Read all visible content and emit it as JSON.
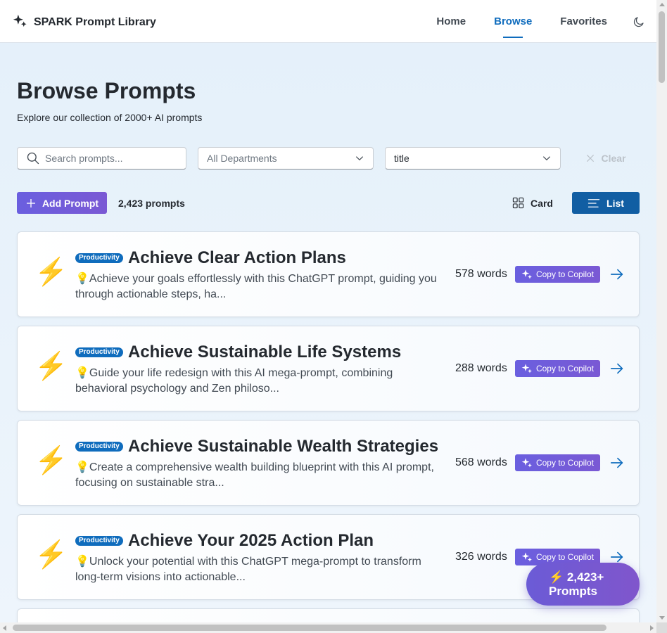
{
  "app": {
    "title": "SPARK Prompt Library",
    "logo_icon": "sparkle-icon"
  },
  "nav": {
    "items": [
      {
        "label": "Home",
        "active": false
      },
      {
        "label": "Browse",
        "active": true
      },
      {
        "label": "Favorites",
        "active": false
      }
    ],
    "theme_icon": "moon-icon"
  },
  "page": {
    "title": "Browse Prompts",
    "subtitle": "Explore our collection of 2000+ AI prompts"
  },
  "filters": {
    "search_placeholder": "Search prompts...",
    "search_value": "",
    "department_selected": "All Departments",
    "sort_selected": "title",
    "clear_label": "Clear"
  },
  "toolbar": {
    "add_label": "Add Prompt",
    "count_label": "2,423 prompts",
    "card_view_label": "Card",
    "list_view_label": "List",
    "active_view": "List"
  },
  "prompts": [
    {
      "category": "Productivity",
      "title": "Achieve Clear Action Plans",
      "description": "💡Achieve your goals effortlessly with this ChatGPT prompt, guiding you through actionable steps, ha...",
      "words": "578 words",
      "copy_label": "Copy to Copilot"
    },
    {
      "category": "Productivity",
      "title": "Achieve Sustainable Life Systems",
      "description": "💡Guide your life redesign with this AI mega-prompt, combining behavioral psychology and Zen philoso...",
      "words": "288 words",
      "copy_label": "Copy to Copilot"
    },
    {
      "category": "Productivity",
      "title": "Achieve Sustainable Wealth Strategies",
      "description": "💡Create a comprehensive wealth building blueprint with this AI prompt, focusing on sustainable stra...",
      "words": "568 words",
      "copy_label": "Copy to Copilot"
    },
    {
      "category": "Productivity",
      "title": "Achieve Your 2025 Action Plan",
      "description": "💡Unlock your potential with this ChatGPT mega-prompt to transform long-term visions into actionable...",
      "words": "326 words",
      "copy_label": "Copy to Copilot"
    }
  ],
  "floating_badge": {
    "label": "⚡ 2,423+ Prompts"
  },
  "colors": {
    "accent": "#0f6cbd",
    "purple": "#6a5fdf",
    "background": "#e4f0fa"
  }
}
